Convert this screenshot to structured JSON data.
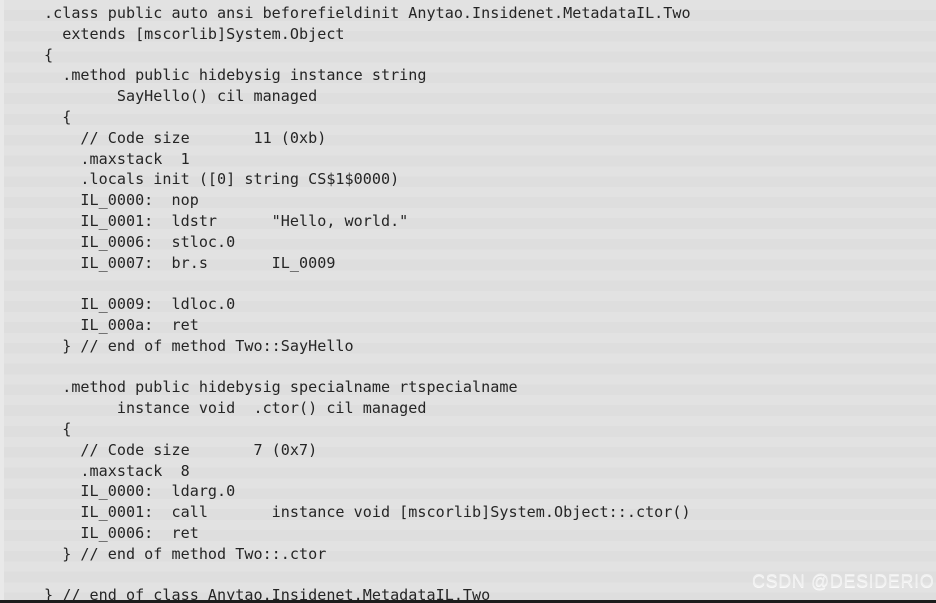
{
  "listing": {
    "language": "CIL / MSIL",
    "background_color": "#e0e0e0",
    "stripe_color": "#e3e3e3",
    "text_color": "#252525",
    "lines": [
      ".class public auto ansi beforefieldinit Anytao.Insidenet.MetadataIL.Two",
      "  extends [mscorlib]System.Object",
      "{",
      "  .method public hidebysig instance string ",
      "        SayHello() cil managed",
      "  {",
      "    // Code size       11 (0xb)",
      "    .maxstack  1",
      "    .locals init ([0] string CS$1$0000)",
      "    IL_0000:  nop",
      "    IL_0001:  ldstr      \"Hello, world.\"",
      "    IL_0006:  stloc.0",
      "    IL_0007:  br.s       IL_0009",
      "",
      "    IL_0009:  ldloc.0",
      "    IL_000a:  ret",
      "  } // end of method Two::SayHello",
      "",
      "  .method public hidebysig specialname rtspecialname ",
      "        instance void  .ctor() cil managed",
      "  {",
      "    // Code size       7 (0x7)",
      "    .maxstack  8",
      "    IL_0000:  ldarg.0",
      "    IL_0001:  call       instance void [mscorlib]System.Object::.ctor()",
      "    IL_0006:  ret",
      "  } // end of method Two::.ctor",
      "",
      "} // end of class Anytao.Insidenet.MetadataIL.Two"
    ]
  },
  "watermark": {
    "text": "CSDN @DESIDERIO",
    "color": "#f2f2f2"
  }
}
